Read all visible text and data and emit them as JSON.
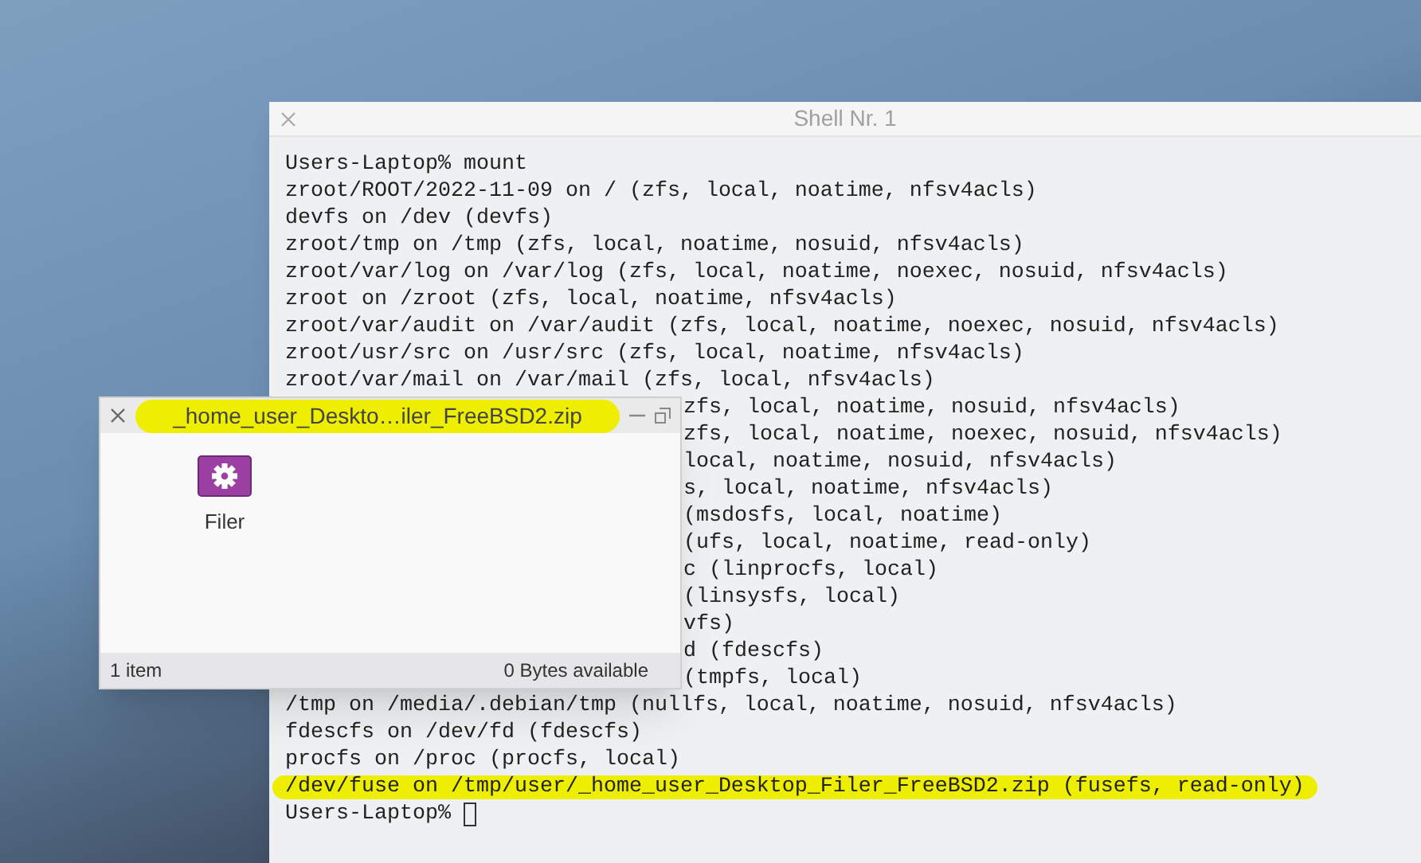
{
  "terminal": {
    "title": "Shell Nr. 1",
    "lines": [
      {
        "kind": "full",
        "text": "Users-Laptop% mount",
        "highlighted": false
      },
      {
        "kind": "full",
        "text": "zroot/ROOT/2022-11-09 on / (zfs, local, noatime, nfsv4acls)",
        "highlighted": false
      },
      {
        "kind": "full",
        "text": "devfs on /dev (devfs)",
        "highlighted": false
      },
      {
        "kind": "full",
        "text": "zroot/tmp on /tmp (zfs, local, noatime, nosuid, nfsv4acls)",
        "highlighted": false
      },
      {
        "kind": "full",
        "text": "zroot/var/log on /var/log (zfs, local, noatime, noexec, nosuid, nfsv4acls)",
        "highlighted": false
      },
      {
        "kind": "full",
        "text": "zroot on /zroot (zfs, local, noatime, nfsv4acls)",
        "highlighted": false
      },
      {
        "kind": "full",
        "text": "zroot/var/audit on /var/audit (zfs, local, noatime, noexec, nosuid, nfsv4acls)",
        "highlighted": false
      },
      {
        "kind": "full",
        "text": "zroot/usr/src on /usr/src (zfs, local, noatime, nfsv4acls)",
        "highlighted": false
      },
      {
        "kind": "full",
        "text": "zroot/var/mail on /var/mail (zfs, local, nfsv4acls)",
        "highlighted": false
      },
      {
        "kind": "partial",
        "text": "zfs, local, noatime, nosuid, nfsv4acls)",
        "highlighted": false
      },
      {
        "kind": "partial",
        "text": "zfs, local, noatime, noexec, nosuid, nfsv4acls)",
        "highlighted": false
      },
      {
        "kind": "partial",
        "text": "local, noatime, nosuid, nfsv4acls)",
        "highlighted": false
      },
      {
        "kind": "partial",
        "text": "s, local, noatime, nfsv4acls)",
        "highlighted": false
      },
      {
        "kind": "partial",
        "text": "(msdosfs, local, noatime)",
        "highlighted": false
      },
      {
        "kind": "partial",
        "text": "(ufs, local, noatime, read-only)",
        "highlighted": false
      },
      {
        "kind": "partial",
        "text": "c (linprocfs, local)",
        "highlighted": false
      },
      {
        "kind": "partial",
        "text": "(linsysfs, local)",
        "highlighted": false
      },
      {
        "kind": "partial",
        "text": "vfs)",
        "highlighted": false
      },
      {
        "kind": "partial",
        "text": "d (fdescfs)",
        "highlighted": false
      },
      {
        "kind": "partial",
        "text": "(tmpfs, local)",
        "highlighted": false
      },
      {
        "kind": "full",
        "text": "/tmp on /media/.debian/tmp (nullfs, local, noatime, nosuid, nfsv4acls)",
        "highlighted": false
      },
      {
        "kind": "full",
        "text": "fdescfs on /dev/fd (fdescfs)",
        "highlighted": false
      },
      {
        "kind": "full",
        "text": "procfs on /proc (procfs, local)",
        "highlighted": false
      },
      {
        "kind": "full",
        "text": "/dev/fuse on /tmp/user/_home_user_Desktop_Filer_FreeBSD2.zip (fusefs, read-only)",
        "highlighted": true
      },
      {
        "kind": "prompt",
        "text": "Users-Laptop%",
        "highlighted": false
      }
    ]
  },
  "file_window": {
    "title": "_home_user_Deskto…iler_FreeBSD2.zip",
    "title_highlighted": true,
    "items": [
      {
        "label": "Filer",
        "selected": false
      }
    ],
    "status_bar": {
      "count": "1 item",
      "free_space": "0 Bytes available"
    }
  }
}
